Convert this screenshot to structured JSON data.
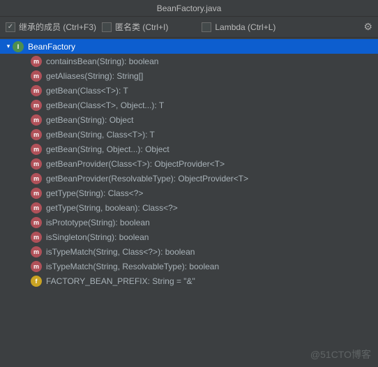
{
  "title": "BeanFactory.java",
  "toolbar": {
    "inherited": {
      "label": "继承的成员 (Ctrl+F3)",
      "checked": true
    },
    "anon": {
      "label": "匿名类 (Ctrl+I)",
      "checked": false
    },
    "lambda": {
      "label": "Lambda (Ctrl+L)",
      "checked": false
    }
  },
  "root": {
    "name": "BeanFactory",
    "kind": "interface",
    "expanded": true
  },
  "members": [
    {
      "kind": "method",
      "sig": "containsBean(String): boolean"
    },
    {
      "kind": "method",
      "sig": "getAliases(String): String[]"
    },
    {
      "kind": "method",
      "sig": "getBean(Class<T>): T"
    },
    {
      "kind": "method",
      "sig": "getBean(Class<T>, Object...): T"
    },
    {
      "kind": "method",
      "sig": "getBean(String): Object"
    },
    {
      "kind": "method",
      "sig": "getBean(String, Class<T>): T"
    },
    {
      "kind": "method",
      "sig": "getBean(String, Object...): Object"
    },
    {
      "kind": "method",
      "sig": "getBeanProvider(Class<T>): ObjectProvider<T>"
    },
    {
      "kind": "method",
      "sig": "getBeanProvider(ResolvableType): ObjectProvider<T>"
    },
    {
      "kind": "method",
      "sig": "getType(String): Class<?>"
    },
    {
      "kind": "method",
      "sig": "getType(String, boolean): Class<?>"
    },
    {
      "kind": "method",
      "sig": "isPrototype(String): boolean"
    },
    {
      "kind": "method",
      "sig": "isSingleton(String): boolean"
    },
    {
      "kind": "method",
      "sig": "isTypeMatch(String, Class<?>): boolean"
    },
    {
      "kind": "method",
      "sig": "isTypeMatch(String, ResolvableType): boolean"
    },
    {
      "kind": "field",
      "sig": "FACTORY_BEAN_PREFIX: String = \"&\""
    }
  ],
  "watermark": "@51CTO博客",
  "icon_letter": {
    "interface": "I",
    "method": "m",
    "field": "f"
  }
}
